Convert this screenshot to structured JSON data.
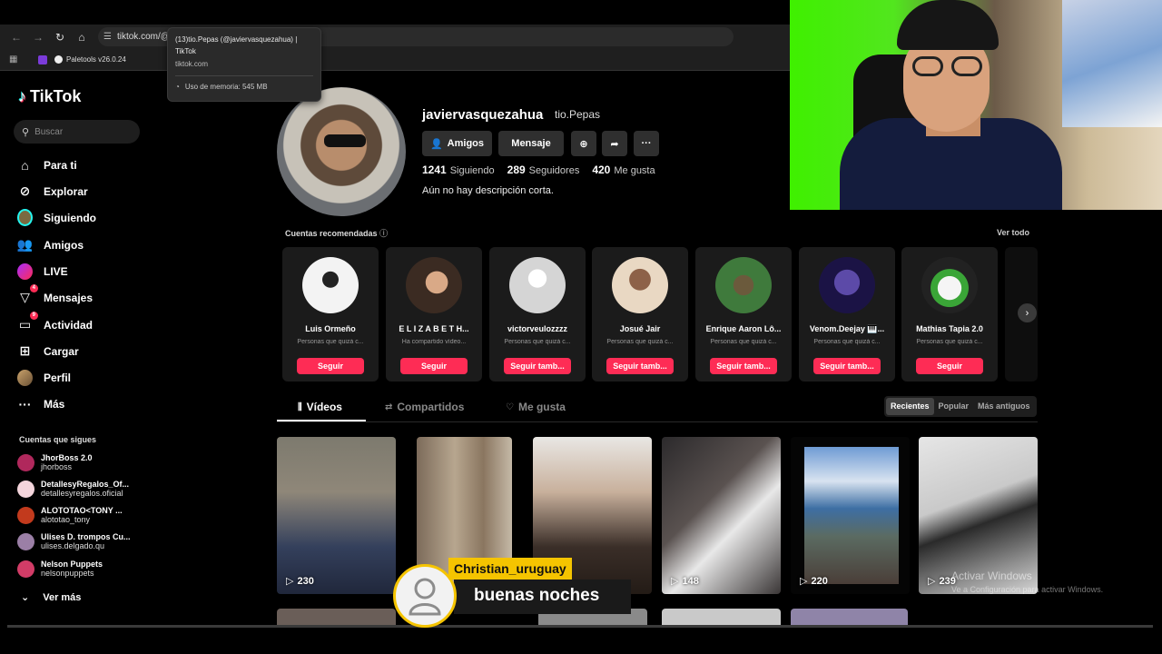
{
  "browser": {
    "url": "tiktok.com/@",
    "bookmark": "Paletools v26.0.24",
    "tooltip": {
      "title": "(13)tio.Pepas (@javiervasquezahua) | TikTok",
      "url": "tiktok.com",
      "memory": "Uso de memoria: 545 MB"
    }
  },
  "sidebar": {
    "logo": "TikTok",
    "search_placeholder": "Buscar",
    "nav": [
      {
        "label": "Para ti",
        "icon": "home-icon"
      },
      {
        "label": "Explorar",
        "icon": "compass-icon"
      },
      {
        "label": "Siguiendo",
        "icon": "following-avatar-icon"
      },
      {
        "label": "Amigos",
        "icon": "friends-icon"
      },
      {
        "label": "LIVE",
        "icon": "live-icon"
      },
      {
        "label": "Mensajes",
        "icon": "messages-icon",
        "badge": "4"
      },
      {
        "label": "Actividad",
        "icon": "activity-icon",
        "badge": "9"
      },
      {
        "label": "Cargar",
        "icon": "upload-icon"
      },
      {
        "label": "Perfil",
        "icon": "profile-avatar-icon"
      },
      {
        "label": "Más",
        "icon": "more-icon"
      }
    ],
    "following_title": "Cuentas que sigues",
    "following": [
      {
        "name": "JhorBoss 2.0",
        "handle": "jhorboss"
      },
      {
        "name": "DetallesyRegalos_Of...",
        "handle": "detallesyregalos.oficial"
      },
      {
        "name": "ALOTOTAO<TONY ...",
        "handle": "alototao_tony"
      },
      {
        "name": "Ulises D. trompos Cu...",
        "handle": "ulises.delgado.qu"
      },
      {
        "name": "Nelson Puppets",
        "handle": "nelsonpuppets"
      }
    ],
    "see_more": "Ver más"
  },
  "profile": {
    "username": "javiervasquezahua",
    "nickname": "tio.Pepas",
    "buttons": {
      "friends": "Amigos",
      "message": "Mensaje"
    },
    "stats": [
      {
        "value": "1241",
        "label": "Siguiendo"
      },
      {
        "value": "289",
        "label": "Seguidores"
      },
      {
        "value": "420",
        "label": "Me gusta"
      }
    ],
    "bio": "Aún no hay descripción corta."
  },
  "recommended": {
    "title": "Cuentas recomendadas",
    "see_all": "Ver todo",
    "accounts": [
      {
        "name": "Luis Ormeño",
        "sub": "Personas que quizá c...",
        "button": "Seguir"
      },
      {
        "name": "E L I Z A B E T H...",
        "sub": "Ha compartido vídeo...",
        "button": "Seguir"
      },
      {
        "name": "victorveulozzzz",
        "sub": "Personas que quizá c...",
        "button": "Seguir tamb..."
      },
      {
        "name": "Josué Jair",
        "sub": "Personas que quizá c...",
        "button": "Seguir tamb..."
      },
      {
        "name": "Enrique Aaron Lô...",
        "sub": "Personas que quizá c...",
        "button": "Seguir tamb..."
      },
      {
        "name": "Venom.Deejay 🎹...",
        "sub": "Personas que quizá c...",
        "button": "Seguir tamb..."
      },
      {
        "name": "Mathias Tapia 2.0",
        "sub": "Personas que quizá c...",
        "button": "Seguir"
      }
    ]
  },
  "tabs": {
    "videos": "Vídeos",
    "shared": "Compartidos",
    "liked": "Me gusta"
  },
  "sort": {
    "recent": "Recientes",
    "popular": "Popular",
    "oldest": "Más antiguos"
  },
  "videos": [
    {
      "views": "230"
    },
    {
      "views": ""
    },
    {
      "views": ""
    },
    {
      "views": "148"
    },
    {
      "views": "220"
    },
    {
      "views": "239"
    }
  ],
  "watermark": {
    "line1": "Activar Windows",
    "line2": "Ve a Configuración para activar Windows."
  },
  "chat": {
    "user": "Christian_uruguay",
    "message": "buenas noches"
  }
}
